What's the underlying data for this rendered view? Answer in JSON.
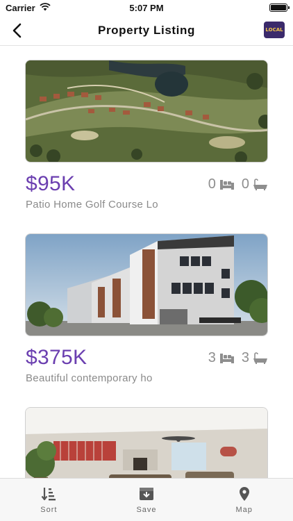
{
  "status_bar": {
    "carrier": "Carrier",
    "time": "5:07 PM"
  },
  "nav": {
    "title": "Property Listing",
    "logo_text": "LOCAL"
  },
  "listings": [
    {
      "price": "$95K",
      "beds": "0",
      "baths": "0",
      "address": "Patio Home Golf Course Lo",
      "image": "aerial-golf-course-image"
    },
    {
      "price": "$375K",
      "beds": "3",
      "baths": "3",
      "address": "Beautiful contemporary ho",
      "image": "contemporary-townhouse-image"
    },
    {
      "image": "living-room-interior-image"
    }
  ],
  "tab_bar": {
    "items": [
      {
        "label": "Sort",
        "icon": "sort-icon"
      },
      {
        "label": "Save",
        "icon": "save-icon"
      },
      {
        "label": "Map",
        "icon": "map-pin-icon"
      }
    ]
  },
  "colors": {
    "price": "#6b3fb0",
    "muted_text": "#8a8a8a",
    "icon_gray": "#8e8e8e",
    "tab_bar_bg": "#f7f7f7"
  }
}
